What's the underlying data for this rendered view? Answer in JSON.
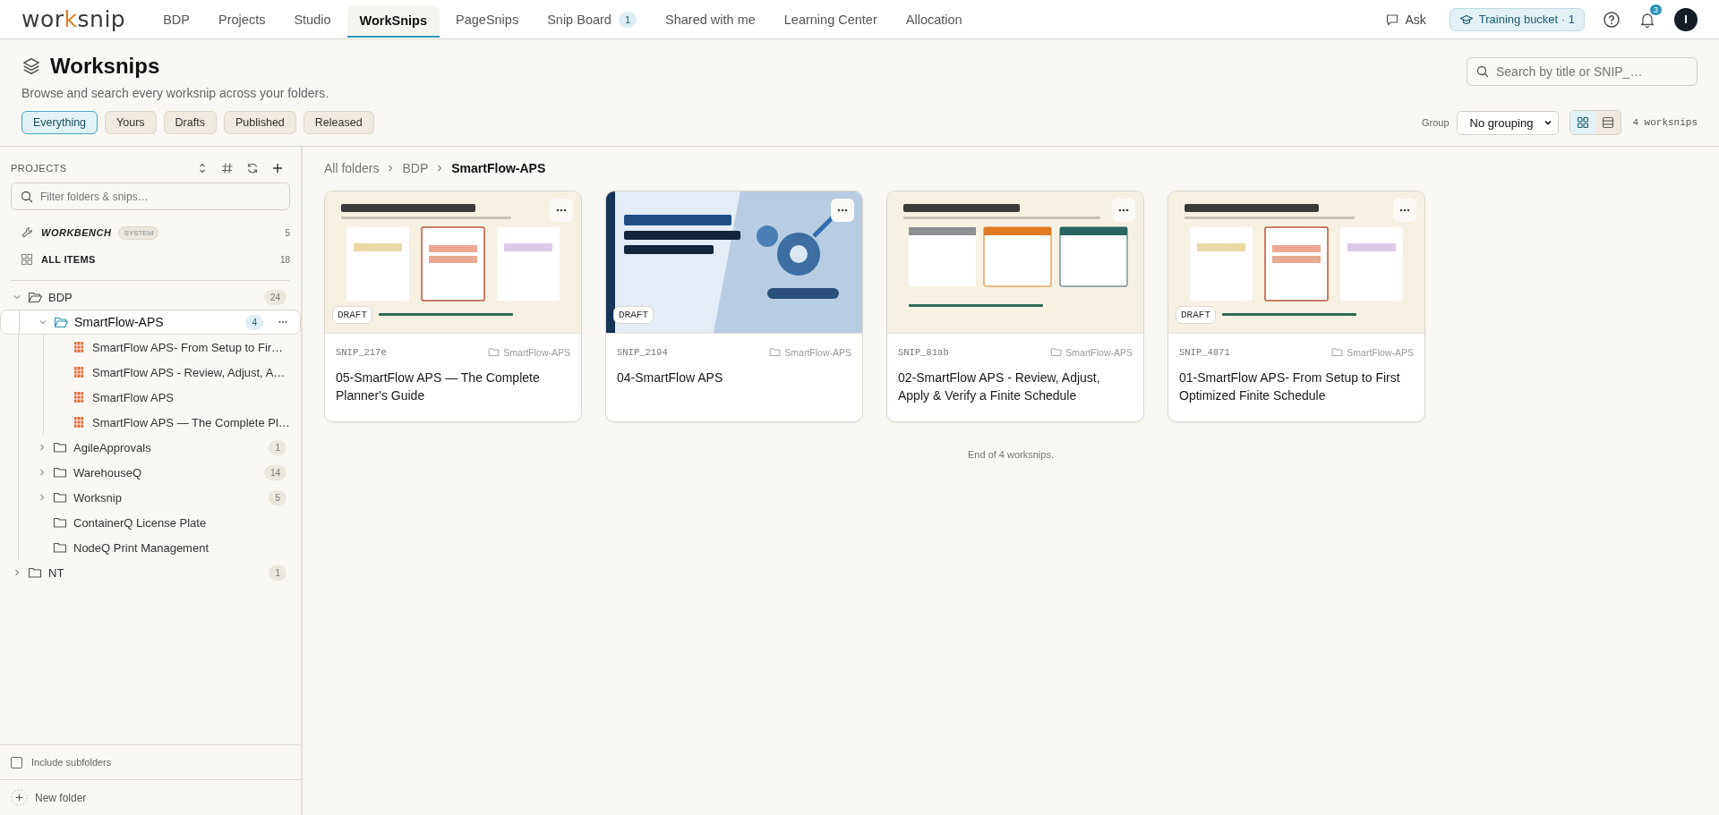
{
  "app": {
    "logo": {
      "text": "worksnip"
    }
  },
  "nav": [
    {
      "label": "BDP",
      "selected": false
    },
    {
      "label": "Projects",
      "selected": false
    },
    {
      "label": "Studio",
      "selected": false
    },
    {
      "label": "WorkSnips",
      "selected": true
    },
    {
      "label": "PageSnips",
      "selected": false
    },
    {
      "label": "Snip Board",
      "selected": false,
      "badge": "1"
    },
    {
      "label": "Shared with me",
      "selected": false
    },
    {
      "label": "Learning Center",
      "selected": false
    },
    {
      "label": "Allocation",
      "selected": false
    }
  ],
  "topbar_actions": {
    "ask": "Ask",
    "bucket": "Training bucket · 1",
    "notifications": "3",
    "avatar": "I"
  },
  "header": {
    "title": "Worksnips",
    "description": "Browse and search every worksnip across your folders.",
    "search_placeholder": "Search by title or SNIP_…",
    "filters": [
      {
        "label": "Everything",
        "selected": true
      },
      {
        "label": "Yours",
        "selected": false
      },
      {
        "label": "Drafts",
        "selected": false
      },
      {
        "label": "Published",
        "selected": false
      },
      {
        "label": "Released",
        "selected": false
      }
    ],
    "group_label": "Group",
    "grouping": "No grouping",
    "views": [
      {
        "kind": "grid",
        "selected": true
      },
      {
        "kind": "list",
        "selected": false
      }
    ],
    "count": "4 worksnips"
  },
  "sidebar": {
    "title": "PROJECTS",
    "filter_placeholder": "Filter folders & snips…",
    "workbench": {
      "label": "WORKBENCH",
      "badge": "SYSTEM",
      "count": "5"
    },
    "all_items": {
      "label": "ALL ITEMS",
      "count": "18"
    },
    "tree": [
      {
        "kind": "folder",
        "label": "BDP",
        "count": "24",
        "expandable": true,
        "expanded": true,
        "selected": false,
        "children": [
          {
            "kind": "folder",
            "label": "SmartFlow-APS",
            "count": "4",
            "expandable": true,
            "expanded": true,
            "selected": true,
            "children": [
              {
                "kind": "snip",
                "label": "SmartFlow APS- From Setup to Fir…",
                "selected": false
              },
              {
                "kind": "snip",
                "label": "SmartFlow APS - Review, Adjust, A…",
                "selected": false
              },
              {
                "kind": "snip",
                "label": "SmartFlow APS",
                "selected": false
              },
              {
                "kind": "snip",
                "label": "SmartFlow APS — The Complete Pl…",
                "selected": false
              }
            ]
          },
          {
            "kind": "folder",
            "label": "AgileApprovals",
            "count": "1",
            "expandable": true,
            "expanded": false,
            "selected": false
          },
          {
            "kind": "folder",
            "label": "WarehouseQ",
            "count": "14",
            "expandable": true,
            "expanded": false,
            "selected": false
          },
          {
            "kind": "folder",
            "label": "Worksnip",
            "count": "5",
            "expandable": true,
            "expanded": false,
            "selected": false
          },
          {
            "kind": "folder",
            "label": "ContainerQ License Plate",
            "expandable": false,
            "expanded": false,
            "selected": false
          },
          {
            "kind": "folder",
            "label": "NodeQ Print Management",
            "expandable": false,
            "expanded": false,
            "selected": false
          }
        ]
      },
      {
        "kind": "folder",
        "label": "NT",
        "count": "1",
        "expandable": true,
        "expanded": false,
        "selected": false
      }
    ],
    "include_subfolders": {
      "label": "Include subfolders",
      "checked": false
    },
    "new_folder": "New folder"
  },
  "breadcrumb": [
    "All folders",
    "BDP",
    "SmartFlow-APS"
  ],
  "cards": [
    {
      "id": "SNIP_217e",
      "folder": "SmartFlow-APS",
      "title": "05-SmartFlow APS — The Complete Planner's Guide",
      "badge": "DRAFT"
    },
    {
      "id": "SNIP_2194",
      "folder": "SmartFlow-APS",
      "title": "04-SmartFlow APS",
      "badge": "DRAFT"
    },
    {
      "id": "SNIP_81ab",
      "folder": "SmartFlow-APS",
      "title": "02-SmartFlow APS - Review, Adjust, Apply & Verify a Finite Schedule"
    },
    {
      "id": "SNIP_4871",
      "folder": "SmartFlow-APS",
      "title": "01-SmartFlow APS- From Setup to First Optimized Finite Schedule",
      "badge": "DRAFT"
    }
  ],
  "end_note": "End of 4 worksnips."
}
